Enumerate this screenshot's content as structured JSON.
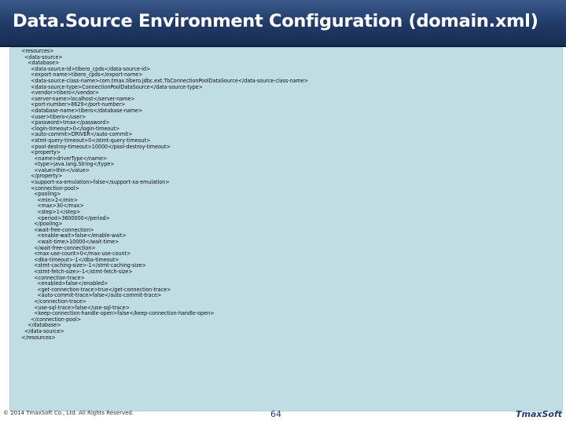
{
  "slide": {
    "title": "Data.Source Environment Configuration (domain.xml)",
    "code_lines": [
      "<resources>",
      "  <data-source>",
      "    <database>",
      "      <data-source-id>tibero_cpds</data-source-id>",
      "      <export-name>tibero_cpds</export-name>",
      "      <data-source-class-name>com.tmax.tibero.jdbc.ext.TbConnectionPoolDataSource</data-source-class-name>",
      "      <data-source-type>ConnectionPoolDataSource</data-source-type>",
      "      <vendor>tibero</vendor>",
      "      <server-name>localhost</server-name>",
      "      <port-number>8629</port-number>",
      "      <database-name>tibero</database-name>",
      "      <user>tibero</user>",
      "      <password>tmax</password>",
      "      <login-timeout>0</login-timeout>",
      "      <auto-commit>DRIVER</auto-commit>",
      "      <stmt-query-timeout>0</stmt-query-timeout>",
      "      <pool-destroy-timeout>10000</pool-destroy-timeout>",
      "      <property>",
      "        <name>driverType</name>",
      "        <type>java.lang.String</type>",
      "        <value>thin</value>",
      "      </property>",
      "      <support-xa-emulation>false</support-xa-emulation>",
      "      <connection-pool>",
      "        <pooling>",
      "          <min>2</min>",
      "          <max>30</max>",
      "          <step>1</step>",
      "          <period>3600000</period>",
      "        </pooling>",
      "        <wait-free-connection>",
      "          <enable-wait>false</enable-wait>",
      "          <wait-time>10000</wait-time>",
      "        </wait-free-connection>",
      "        <max-use-count>0</max-use-count>",
      "        <dba-timeout>-1</dba-timeout>",
      "        <stmt-caching-size>-1</stmt-caching-size>",
      "        <stmt-fetch-size>-1</stmt-fetch-size>",
      "        <connection-trace>",
      "          <enabled>false</enabled>",
      "          <get-connection-trace>true</get-connection-trace>",
      "          <auto-commit-trace>false</auto-commit-trace>",
      "        </connection-trace>",
      "        <use-sql-trace>false</use-sql-trace>",
      "        <keep-connection-handle-open>false</keep-connection-handle-open>",
      "      </connection-pool>",
      "    </database>",
      "  </data-source>",
      "</resources>"
    ]
  },
  "footer": {
    "copyright": "© 2014 TmaxSoft Co., Ltd. All Rights Reserved.",
    "page_number": "64",
    "logo_text": "TmaxSoft"
  },
  "colors": {
    "title_bar": "#203a66",
    "code_background": "#bfdde3",
    "accent": "#1f3f78"
  }
}
